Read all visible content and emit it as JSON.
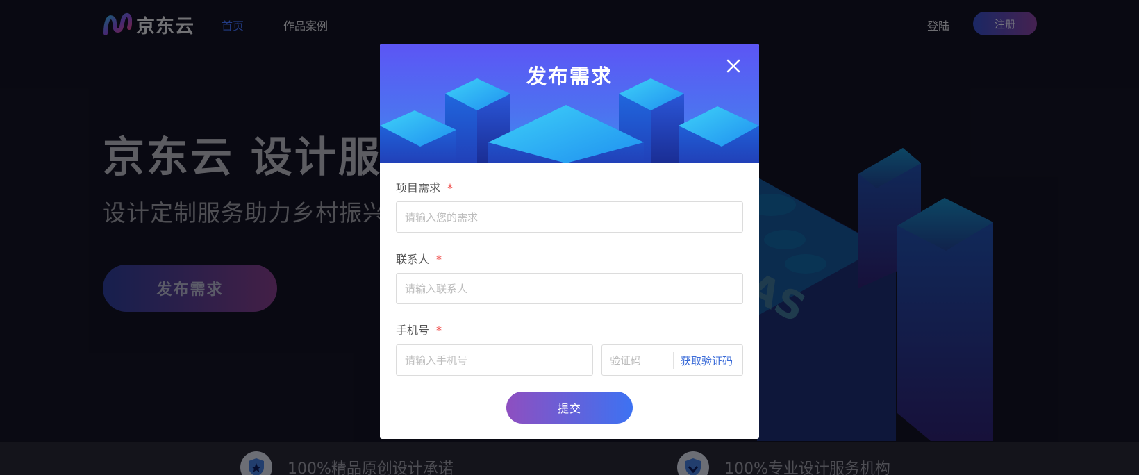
{
  "nav": {
    "logo_text": "京东云",
    "home": "首页",
    "cases": "作品案例",
    "login": "登陆",
    "register": "注册"
  },
  "hero": {
    "title": "京东云 设计服务",
    "subtitle": "设计定制服务助力乡村振兴",
    "cta": "发布需求"
  },
  "promises": [
    {
      "icon": "shield-star-icon",
      "text": "100%精品原创设计承诺"
    },
    {
      "icon": "shield-check-icon",
      "text": "100%专业设计服务机构"
    }
  ],
  "modal": {
    "title": "发布需求",
    "fields": {
      "project": {
        "label": "项目需求",
        "required_mark": "*",
        "placeholder": "请输入您的需求",
        "value": ""
      },
      "contact": {
        "label": "联系人",
        "required_mark": "*",
        "placeholder": "请输入联系人",
        "value": ""
      },
      "phone": {
        "label": "手机号",
        "required_mark": "*",
        "placeholder": "请输入手机号",
        "value": ""
      },
      "code": {
        "placeholder": "验证码",
        "value": "",
        "get_code_label": "获取验证码"
      }
    },
    "submit": "提交"
  },
  "colors": {
    "accent": "#3e6cf0",
    "required": "#f0524f",
    "link": "#3a6bd8"
  }
}
